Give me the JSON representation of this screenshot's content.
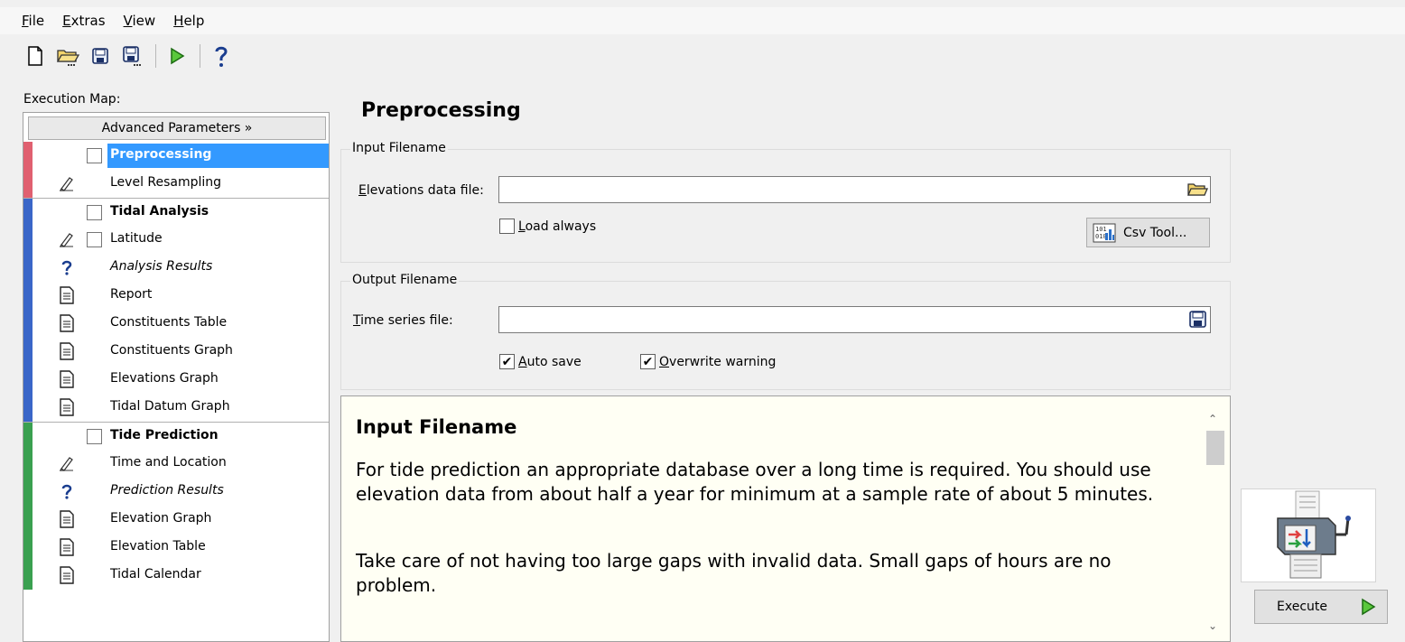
{
  "menu": {
    "items": [
      {
        "accel": "F",
        "rest": "ile"
      },
      {
        "accel": "E",
        "rest": "xtras"
      },
      {
        "accel": "V",
        "rest": "iew"
      },
      {
        "accel": "H",
        "rest": "elp"
      }
    ]
  },
  "toolbar": {
    "icons": [
      "new-file-icon",
      "open-folder-icon",
      "save-icon",
      "save-as-icon",
      "run-icon",
      "help-icon"
    ]
  },
  "execution_map": {
    "label": "Execution Map:",
    "advanced_button": "Advanced Parameters »",
    "items": [
      {
        "label": "Preprocessing",
        "icon": "",
        "checkbox": true,
        "style": "selected",
        "bar": "red"
      },
      {
        "label": "Level Resampling",
        "icon": "pen-icon",
        "checkbox": false,
        "style": "normal",
        "bar": "red"
      },
      {
        "label": "Tidal Analysis",
        "icon": "",
        "checkbox": true,
        "style": "bold",
        "bar": "blue"
      },
      {
        "label": "Latitude",
        "icon": "pen-icon",
        "checkbox": true,
        "style": "normal",
        "bar": "blue"
      },
      {
        "label": "Analysis Results",
        "icon": "question-icon",
        "checkbox": false,
        "style": "italic",
        "bar": "blue"
      },
      {
        "label": "Report",
        "icon": "document-icon",
        "checkbox": false,
        "style": "normal",
        "bar": "blue"
      },
      {
        "label": "Constituents Table",
        "icon": "document-icon",
        "checkbox": false,
        "style": "normal",
        "bar": "blue"
      },
      {
        "label": "Constituents Graph",
        "icon": "document-icon",
        "checkbox": false,
        "style": "normal",
        "bar": "blue"
      },
      {
        "label": "Elevations Graph",
        "icon": "document-icon",
        "checkbox": false,
        "style": "normal",
        "bar": "blue"
      },
      {
        "label": "Tidal Datum Graph",
        "icon": "document-icon",
        "checkbox": false,
        "style": "normal",
        "bar": "blue"
      },
      {
        "label": "Tide Prediction",
        "icon": "",
        "checkbox": true,
        "style": "bold",
        "bar": "green"
      },
      {
        "label": "Time and Location",
        "icon": "pen-icon",
        "checkbox": false,
        "style": "normal",
        "bar": "green"
      },
      {
        "label": "Prediction Results",
        "icon": "question-icon",
        "checkbox": false,
        "style": "italic",
        "bar": "green"
      },
      {
        "label": "Elevation Graph",
        "icon": "document-icon",
        "checkbox": false,
        "style": "normal",
        "bar": "green"
      },
      {
        "label": "Elevation Table",
        "icon": "document-icon",
        "checkbox": false,
        "style": "normal",
        "bar": "green"
      },
      {
        "label": "Tidal Calendar",
        "icon": "document-icon",
        "checkbox": false,
        "style": "normal",
        "bar": "green"
      }
    ]
  },
  "main": {
    "title": "Preprocessing",
    "input_group": {
      "title": "Input Filename",
      "elevations_label_accel": "E",
      "elevations_label_rest": "levations data file:",
      "elevations_value": "",
      "load_always_accel": "L",
      "load_always_rest": "oad always",
      "load_always_checked": false,
      "csv_tool_label": "Csv Tool..."
    },
    "output_group": {
      "title": "Output Filename",
      "timeseries_label_accel": "T",
      "timeseries_label_rest": "ime series file:",
      "timeseries_value": "",
      "auto_save_accel": "A",
      "auto_save_rest": "uto save",
      "auto_save_checked": true,
      "overwrite_accel": "O",
      "overwrite_rest": "verwrite warning",
      "overwrite_checked": true
    },
    "help": {
      "heading": "Input Filename",
      "paragraph1": "For tide prediction an appropriate database over a long time is required. You should use elevation data from about half a year for minimum at a sample rate of about 5 minutes.",
      "paragraph2": "Take care of not having too large gaps with invalid data. Small gaps of hours are no problem."
    }
  },
  "execute": {
    "label": "Execute"
  },
  "colors": {
    "selection": "#3399ff",
    "bar_red": "#e06070",
    "bar_blue": "#3a66c8",
    "bar_green": "#3aa050",
    "help_bg": "#fffff4"
  }
}
